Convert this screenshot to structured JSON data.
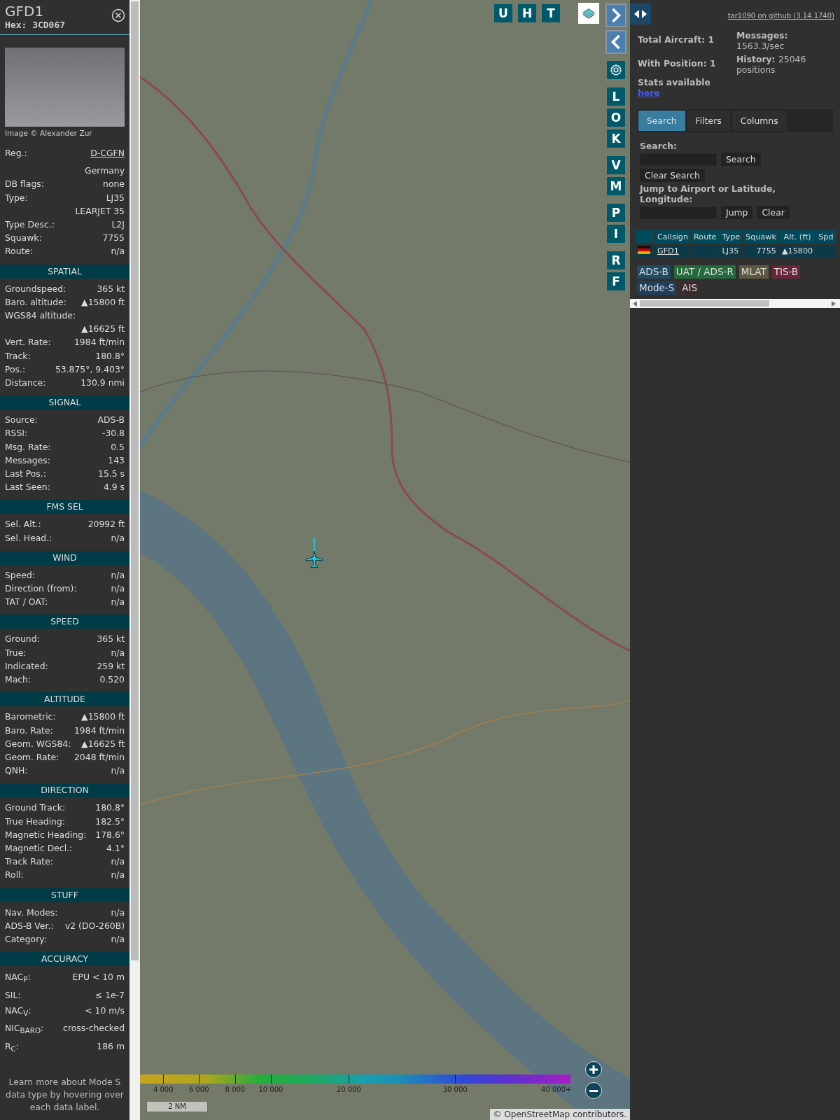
{
  "sidebar": {
    "title": "GFD1",
    "hex": "Hex: 3CD067",
    "photo_credit": "Image © Alexander Zur",
    "registration": {
      "label": "Reg.:",
      "value": "D-CGFN"
    },
    "sections": [
      {
        "rows": [
          {
            "value": "Germany"
          },
          {
            "label": "DB flags:",
            "value": "none"
          },
          {
            "label": "Type:",
            "value": "LJ35"
          },
          {
            "value": "LEARJET 35"
          },
          {
            "label": "Type Desc.:",
            "value": "L2J"
          },
          {
            "label": "Squawk:",
            "value": "7755"
          },
          {
            "label": "Route:",
            "value": "n/a"
          }
        ]
      },
      {
        "title": "SPATIAL",
        "rows": [
          {
            "label": "Groundspeed:",
            "value": "365 kt"
          },
          {
            "label": "Baro. altitude:",
            "value": "▲15800 ft"
          },
          {
            "label": "WGS84 altitude:"
          },
          {
            "value": "▲16625 ft"
          },
          {
            "label": "Vert. Rate:",
            "value": "1984 ft/min"
          },
          {
            "label": "Track:",
            "value": "180.8°"
          },
          {
            "label": "Pos.:",
            "value": "53.875°, 9.403°"
          },
          {
            "label": "Distance:",
            "value": "130.9 nmi"
          }
        ]
      },
      {
        "title": "SIGNAL",
        "rows": [
          {
            "label": "Source:",
            "value": "ADS-B"
          },
          {
            "label": "RSSI:",
            "value": "-30.8"
          },
          {
            "label": "Msg. Rate:",
            "value": "0.5"
          },
          {
            "label": "Messages:",
            "value": "143"
          },
          {
            "label": "Last Pos.:",
            "value": "15.5 s"
          },
          {
            "label": "Last Seen:",
            "value": "4.9 s"
          }
        ]
      },
      {
        "title": "FMS SEL",
        "rows": [
          {
            "label": "Sel. Alt.:",
            "value": "20992 ft"
          },
          {
            "label": "Sel. Head.:",
            "value": "n/a"
          }
        ]
      },
      {
        "title": "WIND",
        "rows": [
          {
            "label": "Speed:",
            "value": "n/a"
          },
          {
            "label": "Direction (from):",
            "value": "n/a"
          },
          {
            "label": "TAT / OAT:",
            "value": "n/a"
          }
        ]
      },
      {
        "title": "SPEED",
        "rows": [
          {
            "label": "Ground:",
            "value": "365 kt"
          },
          {
            "label": "True:",
            "value": "n/a"
          },
          {
            "label": "Indicated:",
            "value": "259 kt"
          },
          {
            "label": "Mach:",
            "value": "0.520"
          }
        ]
      },
      {
        "title": "ALTITUDE",
        "rows": [
          {
            "label": "Barometric:",
            "value": "▲15800 ft"
          },
          {
            "label": "Baro. Rate:",
            "value": "1984 ft/min"
          },
          {
            "label": "Geom. WGS84:",
            "value": "▲16625 ft"
          },
          {
            "label": "Geom. Rate:",
            "value": "2048 ft/min"
          },
          {
            "label": "QNH:",
            "value": "n/a"
          }
        ]
      },
      {
        "title": "DIRECTION",
        "rows": [
          {
            "label": "Ground Track:",
            "value": "180.8°"
          },
          {
            "label": "True Heading:",
            "value": "182.5°"
          },
          {
            "label": "Magnetic Heading:",
            "value": "178.6°"
          },
          {
            "label": "Magnetic Decl.:",
            "value": "4.1°"
          },
          {
            "label": "Track Rate:",
            "value": "n/a"
          },
          {
            "label": "Roll:",
            "value": "n/a"
          }
        ]
      },
      {
        "title": "STUFF",
        "rows": [
          {
            "label": "Nav. Modes:",
            "value": "n/a"
          },
          {
            "label": "ADS-B Ver.:",
            "value": "v2 (DO-260B)"
          },
          {
            "label": "Category:",
            "value": "n/a"
          }
        ]
      },
      {
        "title": "ACCURACY",
        "rows": [
          {
            "label": "NAC$_{P}$:",
            "value": "EPU < 10 m"
          },
          {
            "label": "SIL:",
            "value": "≤ 1e-7"
          },
          {
            "label": "NAC$_{V}$:",
            "value": "< 10 m/s"
          },
          {
            "label": "NIC$_{BARO}$:",
            "value": "cross-checked"
          },
          {
            "label": "R$_{C}$:",
            "value": "186 m"
          }
        ]
      }
    ],
    "footer_note": "Learn more about Mode S data type by hovering over each data label."
  },
  "map": {
    "top_buttons": [
      "U",
      "H",
      "T"
    ],
    "side_button_groups": [
      [
        "L",
        "O",
        "K"
      ],
      [
        "V",
        "M"
      ],
      [
        "P",
        "I"
      ],
      [
        "R",
        "F"
      ]
    ],
    "altitude_legend": [
      "4 000",
      "6 000",
      "8 000",
      "10 000",
      "20 000",
      "30 000",
      "40 000+"
    ],
    "scale": "2 NM",
    "attribution": {
      "text": "© OpenStreetMap",
      "link": "contributors."
    }
  },
  "panel": {
    "github_link": "tar1090 on github (3.14.1740)",
    "stats": {
      "total": "Total Aircraft: 1",
      "with_position": "With Position: 1",
      "messages_label": "Messages:",
      "messages_value": "1563.3/sec",
      "history_label": "History:",
      "history_value": "25046 positions",
      "stats_text": "Stats available",
      "stats_link": "here"
    },
    "tabs": [
      {
        "label": "Search",
        "selected": true
      },
      {
        "label": "Filters",
        "selected": false
      },
      {
        "label": "Columns",
        "selected": false
      }
    ],
    "search": {
      "label": "Search:",
      "search_button": "Search",
      "clear_button": "Clear Search",
      "jump_label": "Jump to Airport or Latitude, Longitude:",
      "jump_button": "Jump",
      "jump_clear_button": "Clear"
    },
    "table": {
      "columns": [
        "Callsign",
        "Route",
        "Type",
        "Squawk",
        "Alt. (ft)",
        "Spd"
      ],
      "rows": [
        {
          "callsign": "GFD1",
          "type": "LJ35",
          "squawk": "7755",
          "altitude": "▲15800"
        }
      ]
    },
    "sources": [
      {
        "label": "ADS-B",
        "color": "#1d4c63"
      },
      {
        "label": "UAT / ADS-R",
        "color": "#246b3c"
      },
      {
        "label": "MLAT",
        "color": "#5e5840"
      },
      {
        "label": "TIS-B",
        "color": "#6a2539"
      },
      {
        "label": "Mode-S",
        "color": "#1f3f5c"
      },
      {
        "label": "AIS",
        "color": "#3a2a2c"
      }
    ]
  }
}
